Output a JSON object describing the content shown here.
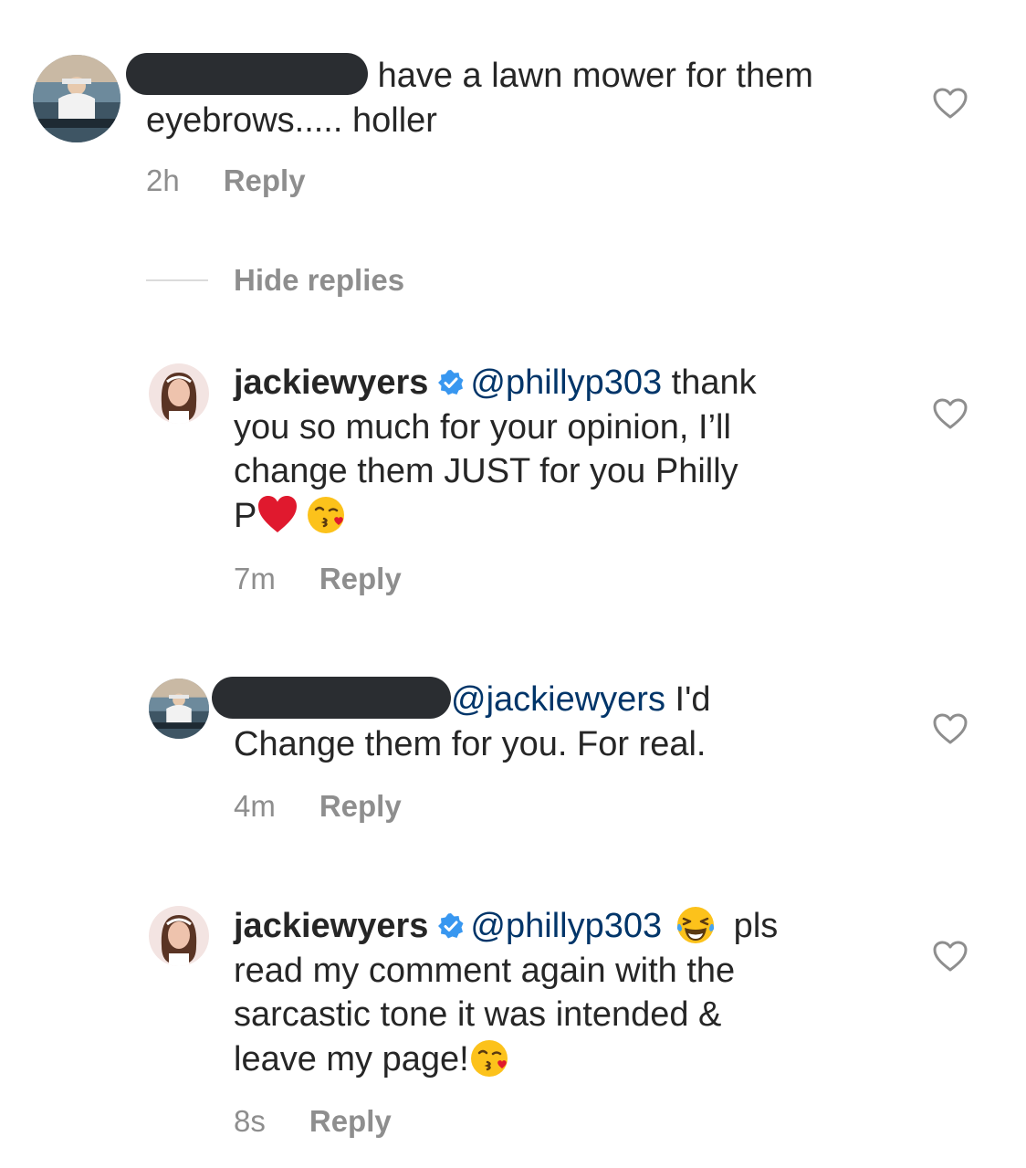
{
  "comments": [
    {
      "text_line1": "have a lawn mower for them",
      "text_line2": "eyebrows..... holler",
      "time": "2h",
      "reply_label": "Reply",
      "avatar_icon": "avatar-man-on-boat"
    },
    {
      "username": "jackiewyers",
      "verified": true,
      "mention": "@phillyp303",
      "text_a": " thank",
      "text_b": "you so much for your opinion, I’ll",
      "text_c": "change them JUST for you Philly",
      "text_d": "P",
      "emojis": [
        "red-heart-icon",
        "kissing-face-icon"
      ],
      "time": "7m",
      "reply_label": "Reply",
      "avatar_icon": "avatar-woman"
    },
    {
      "mention": "@jackiewyers",
      "text_a": " I'd",
      "text_b": "Change them for you. For real.",
      "time": "4m",
      "reply_label": "Reply",
      "avatar_icon": "avatar-man-on-boat"
    },
    {
      "username": "jackiewyers",
      "verified": true,
      "mention": "@phillyp303",
      "text_a": " pls",
      "text_b": "read my comment again with the",
      "text_c": "sarcastic tone it was intended &",
      "text_d": "leave my page!",
      "emojis": [
        "laughing-tears-icon",
        "kissing-face-icon"
      ],
      "time": "8s",
      "reply_label": "Reply",
      "avatar_icon": "avatar-woman"
    }
  ],
  "hide_replies_label": "Hide replies",
  "colors": {
    "text": "#262626",
    "meta": "#8e8e8e",
    "mention": "#003569",
    "verified": "#3897f0",
    "redaction": "#2a2d31"
  }
}
